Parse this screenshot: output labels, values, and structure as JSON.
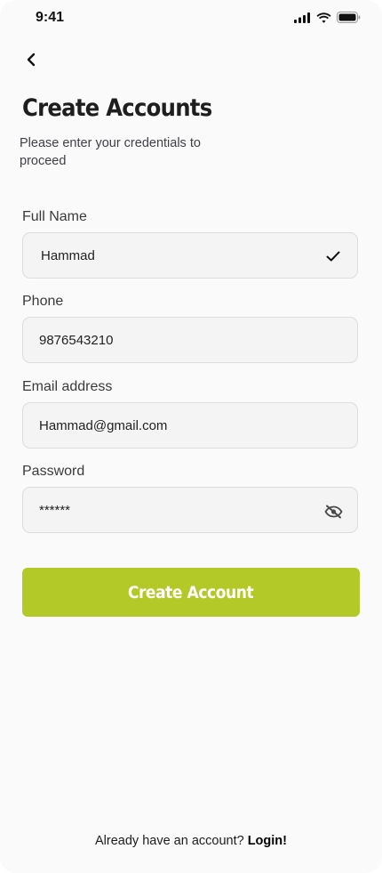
{
  "status_bar": {
    "time": "9:41"
  },
  "header": {
    "title": "Create Accounts",
    "subtitle": "Please enter your credentials to proceed"
  },
  "form": {
    "full_name": {
      "label": "Full Name",
      "value": "Hammad",
      "icon": "checkmark-icon"
    },
    "phone": {
      "label": "Phone",
      "value": "9876543210"
    },
    "email": {
      "label": "Email address",
      "value": "Hammad@gmail.com"
    },
    "password": {
      "label": "Password",
      "value": "******",
      "icon": "eye-off-icon"
    }
  },
  "submit_button": {
    "label": "Create Account",
    "color": "#b2c927"
  },
  "footer": {
    "prompt": "Already have an account?",
    "login_link": "Login!"
  }
}
